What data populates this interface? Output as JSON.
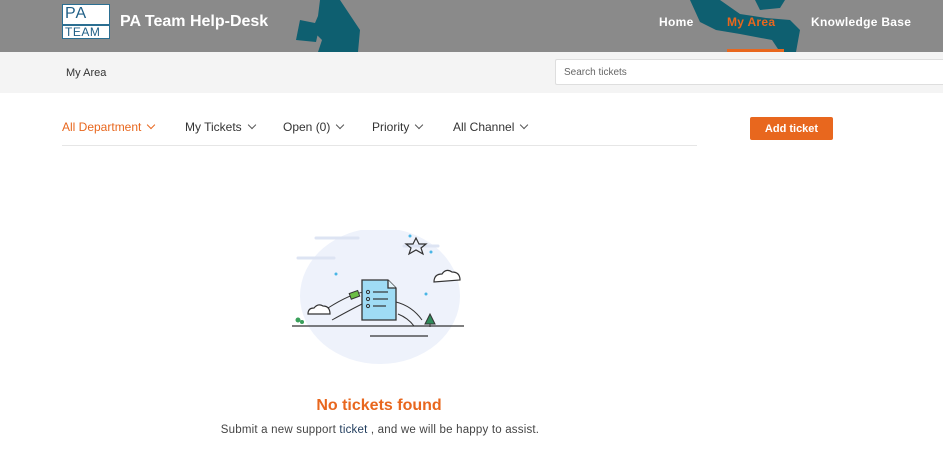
{
  "header": {
    "logo_top": "PA",
    "logo_bottom": "TEAM",
    "brand": "PA Team Help-Desk",
    "nav": [
      {
        "label": "Home"
      },
      {
        "label": "My Area"
      },
      {
        "label": "Knowledge Base"
      }
    ]
  },
  "subbar": {
    "breadcrumb": "My Area",
    "search_placeholder": "Search tickets"
  },
  "filters": [
    {
      "label": "All Department"
    },
    {
      "label": "My Tickets"
    },
    {
      "label": "Open (0)"
    },
    {
      "label": "Priority"
    },
    {
      "label": "All Channel"
    }
  ],
  "add_ticket_label": "Add ticket",
  "empty": {
    "title": "No tickets found",
    "sub_before": "Submit a new support",
    "sub_link": "ticket",
    "sub_after": ", and we will be happy to assist."
  },
  "colors": {
    "accent": "#e8671e",
    "header_bg": "#8a8a8a",
    "header_teal": "#0e5f70"
  }
}
